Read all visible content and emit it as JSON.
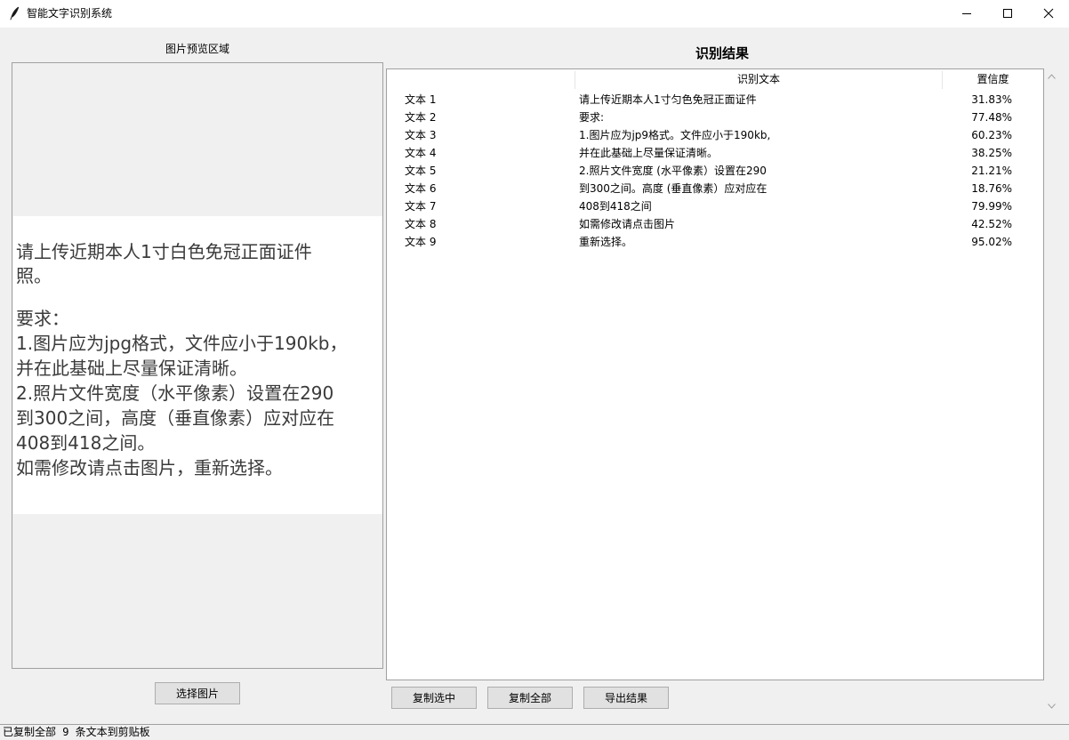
{
  "window": {
    "title": "智能文字识别系统",
    "icon": "feather-icon"
  },
  "left_panel": {
    "preview_label": "图片预览区域",
    "preview_image_text": [
      "请上传近期本人1寸白色免冠正面证件",
      "照。",
      "要求：",
      "1.图片应为jpg格式，文件应小于190kb，",
      "并在此基础上尽量保证清晰。",
      "2.照片文件宽度（水平像素）设置在290",
      "到300之间，高度（垂直像素）应对应在",
      "408到418之间。",
      "如需修改请点击图片，重新选择。"
    ],
    "select_button": "选择图片"
  },
  "right_panel": {
    "title": "识别结果",
    "columns": [
      "",
      "识别文本",
      "置信度"
    ],
    "rows": [
      {
        "id": "文本 1",
        "text": "请上传近期本人1寸匀色免冠正面证件",
        "confidence": "31.83%"
      },
      {
        "id": "文本 2",
        "text": "要求:",
        "confidence": "77.48%"
      },
      {
        "id": "文本 3",
        "text": "1.图片应为jp9格式。文件应小于190kb,",
        "confidence": "60.23%"
      },
      {
        "id": "文本 4",
        "text": "并在此基础上尽量保证清晰。",
        "confidence": "38.25%"
      },
      {
        "id": "文本 5",
        "text": "2.照片文件宽度 (水平像素）设置在290",
        "confidence": "21.21%"
      },
      {
        "id": "文本 6",
        "text": "到300之间。高度 (垂直像素）应对应在",
        "confidence": "18.76%"
      },
      {
        "id": "文本 7",
        "text": "408到418之间",
        "confidence": "79.99%"
      },
      {
        "id": "文本 8",
        "text": "如需修改请点击图片",
        "confidence": "42.52%"
      },
      {
        "id": "文本 9",
        "text": "重新选择。",
        "confidence": "95.02%"
      }
    ],
    "buttons": {
      "copy_selected": "复制选中",
      "copy_all": "复制全部",
      "export": "导出结果"
    }
  },
  "status": {
    "message": "已复制全部 9 条文本到剪贴板"
  }
}
